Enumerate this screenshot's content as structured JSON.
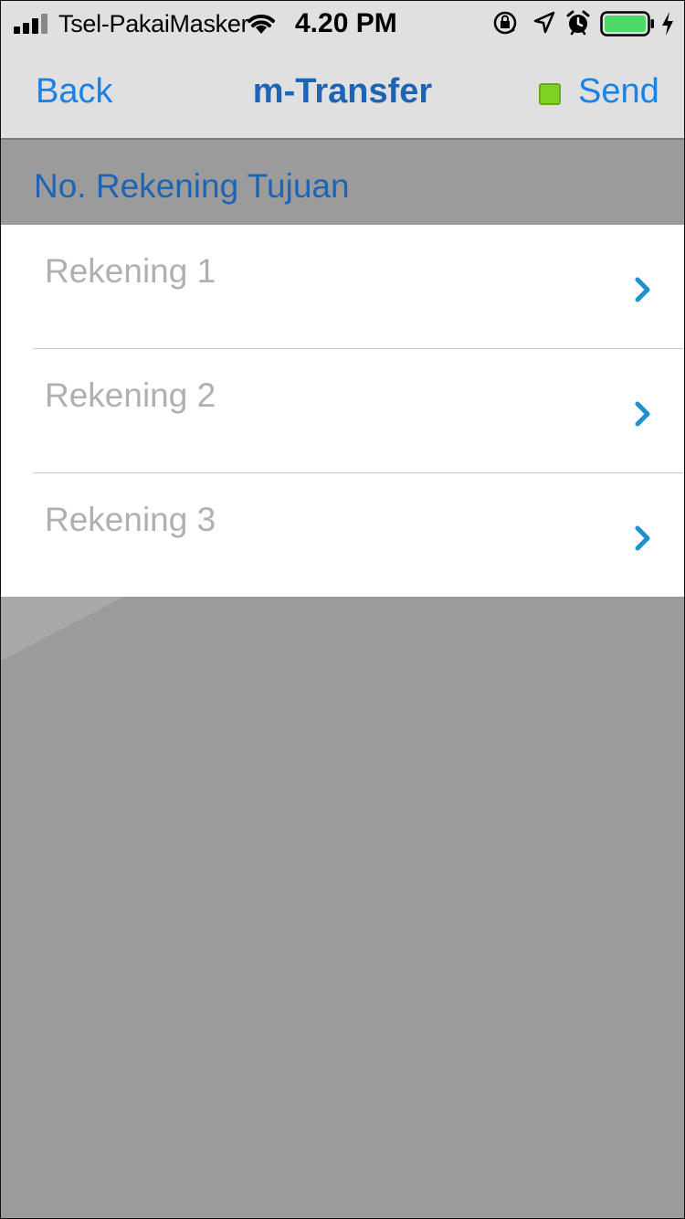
{
  "status_bar": {
    "carrier": "Tsel-PakaiMasker",
    "time": "4.20 PM",
    "icons": [
      "signal-icon",
      "wifi-icon",
      "rotation-lock-icon",
      "location-icon",
      "alarm-icon",
      "battery-icon",
      "charging-icon"
    ],
    "battery_color": "#4cd964"
  },
  "nav": {
    "back_label": "Back",
    "title": "m-Transfer",
    "send_label": "Send",
    "indicator_color": "#7ed321"
  },
  "section": {
    "title": "No. Rekening Tujuan"
  },
  "accounts": [
    {
      "label": "Rekening 1"
    },
    {
      "label": "Rekening 2"
    },
    {
      "label": "Rekening 3"
    }
  ],
  "colors": {
    "accent": "#1a82e6",
    "title": "#1e64b4",
    "chevron": "#1e8fd0",
    "background": "#9b9b9b"
  }
}
